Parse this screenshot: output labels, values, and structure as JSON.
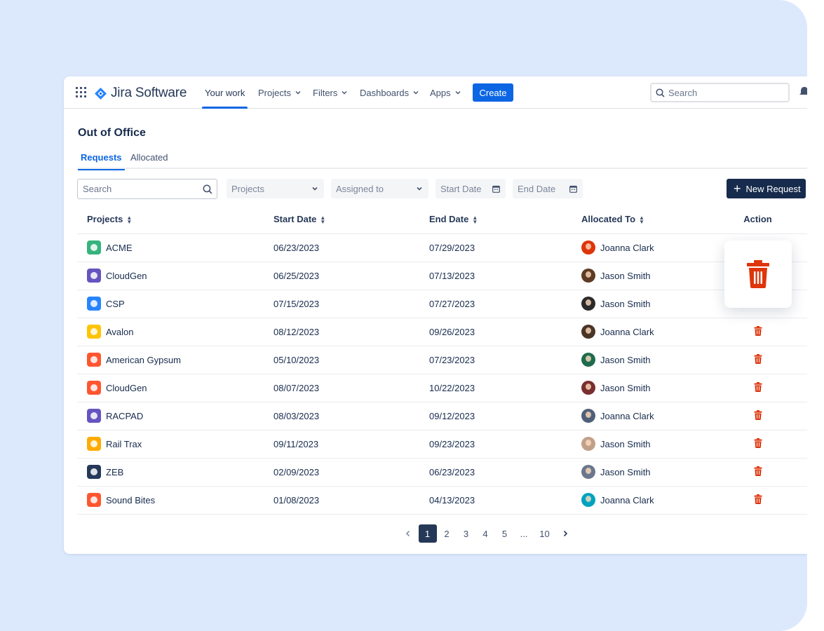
{
  "app": {
    "name": "Jira Software",
    "brand_color": "#0c66e4"
  },
  "nav": {
    "items": [
      {
        "label": "Your work",
        "active": true
      },
      {
        "label": "Projects",
        "dropdown": true
      },
      {
        "label": "Filters",
        "dropdown": true
      },
      {
        "label": "Dashboards",
        "dropdown": true
      },
      {
        "label": "Apps",
        "dropdown": true
      }
    ],
    "create_label": "Create",
    "search_placeholder": "Search"
  },
  "page": {
    "title": "Out of Office",
    "tabs": [
      {
        "label": "Requests",
        "active": true
      },
      {
        "label": "Allocated",
        "active": false
      }
    ]
  },
  "filters": {
    "search_placeholder": "Search",
    "projects_placeholder": "Projects",
    "assigned_placeholder": "Assigned to",
    "start_date_placeholder": "Start Date",
    "end_date_placeholder": "End Date",
    "new_request_label": "New Request"
  },
  "table": {
    "columns": [
      "Projects",
      "Start Date",
      "End Date",
      "Allocated To",
      "Action"
    ],
    "rows": [
      {
        "project": "ACME",
        "start": "06/23/2023",
        "end": "07/29/2023",
        "allocated": "Joanna Clark",
        "icon_color": "#36b37e",
        "avatar_color": "#de350b"
      },
      {
        "project": "CloudGen",
        "start": "06/25/2023",
        "end": "07/13/2023",
        "allocated": "Jason Smith",
        "icon_color": "#6554c0",
        "avatar_color": "#5e3b22"
      },
      {
        "project": "CSP",
        "start": "07/15/2023",
        "end": "07/27/2023",
        "allocated": "Jason Smith",
        "icon_color": "#2684ff",
        "avatar_color": "#2b2b2b"
      },
      {
        "project": "Avalon",
        "start": "08/12/2023",
        "end": "09/26/2023",
        "allocated": "Joanna Clark",
        "icon_color": "#ffc400",
        "avatar_color": "#4a3426"
      },
      {
        "project": "American Gypsum",
        "start": "05/10/2023",
        "end": "07/23/2023",
        "allocated": "Jason Smith",
        "icon_color": "#ff5630",
        "avatar_color": "#1f6b4e"
      },
      {
        "project": "CloudGen",
        "start": "08/07/2023",
        "end": "10/22/2023",
        "allocated": "Jason Smith",
        "icon_color": "#ff5630",
        "avatar_color": "#7a2e2e"
      },
      {
        "project": "RACPAD",
        "start": "08/03/2023",
        "end": "09/12/2023",
        "allocated": "Joanna Clark",
        "icon_color": "#6554c0",
        "avatar_color": "#505f79"
      },
      {
        "project": "Rail Trax",
        "start": "09/11/2023",
        "end": "09/23/2023",
        "allocated": "Jason Smith",
        "icon_color": "#ffab00",
        "avatar_color": "#c1a08a"
      },
      {
        "project": "ZEB",
        "start": "02/09/2023",
        "end": "06/23/2023",
        "allocated": "Jason Smith",
        "icon_color": "#253858",
        "avatar_color": "#6b778c"
      },
      {
        "project": "Sound Bites",
        "start": "01/08/2023",
        "end": "04/13/2023",
        "allocated": "Joanna Clark",
        "icon_color": "#ff5630",
        "avatar_color": "#00a3bf"
      }
    ]
  },
  "pagination": {
    "pages": [
      "1",
      "2",
      "3",
      "4",
      "5",
      "...",
      "10"
    ],
    "current": "1"
  },
  "colors": {
    "delete": "#de350b",
    "dark_button": "#172b4d",
    "background": "#dce9fd"
  }
}
